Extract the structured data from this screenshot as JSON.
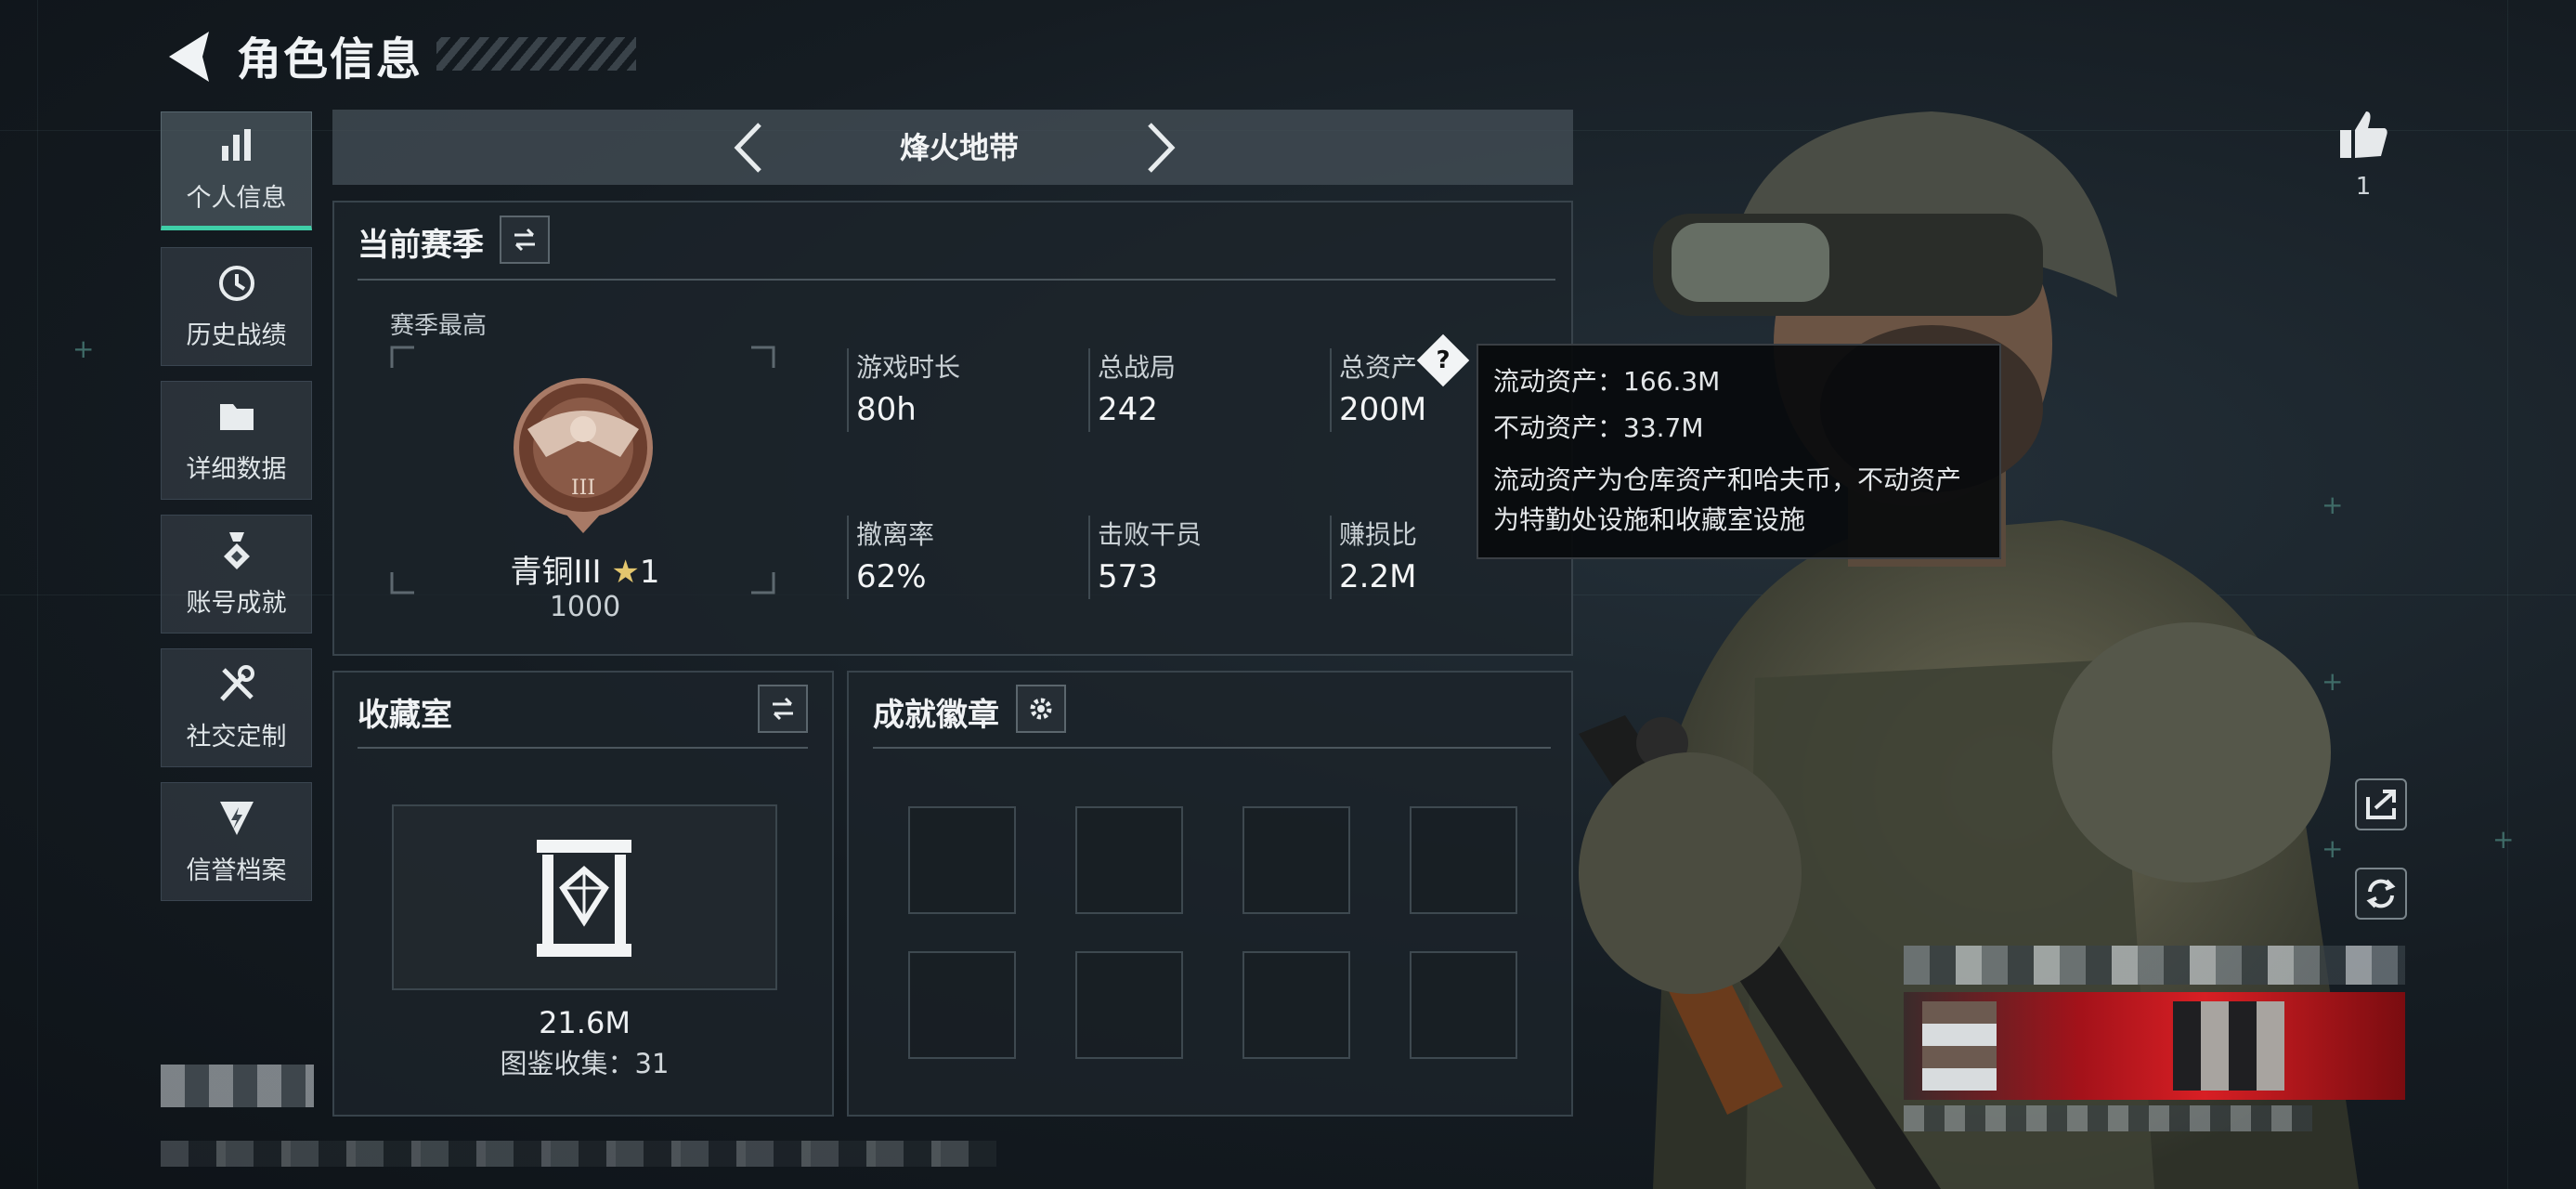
{
  "header": {
    "title": "角色信息"
  },
  "sidebar": {
    "items": [
      {
        "label": "个人信息",
        "icon": "bar-chart-icon",
        "active": true
      },
      {
        "label": "历史战绩",
        "icon": "clock-icon",
        "active": false
      },
      {
        "label": "详细数据",
        "icon": "folder-icon",
        "active": false
      },
      {
        "label": "账号成就",
        "icon": "medal-icon",
        "active": false
      },
      {
        "label": "社交定制",
        "icon": "tools-icon",
        "active": false
      },
      {
        "label": "信誉档案",
        "icon": "shield-icon",
        "active": false
      }
    ]
  },
  "mode_tab": {
    "title": "烽火地带"
  },
  "season": {
    "title": "当前赛季",
    "best_label": "赛季最高",
    "rank_name": "青铜III",
    "rank_stars": "1",
    "rank_points": "1000",
    "stats": [
      {
        "label": "游戏时长",
        "value": "80h"
      },
      {
        "label": "总战局",
        "value": "242"
      },
      {
        "label": "总资产",
        "value": "200M"
      },
      {
        "label": "撤离率",
        "value": "62%"
      },
      {
        "label": "击败干员",
        "value": "573"
      },
      {
        "label": "赚损比",
        "value": "2.2M"
      }
    ]
  },
  "tooltip": {
    "line1": "流动资产：166.3M",
    "line2": "不动资产：33.7M",
    "line3": "流动资产为仓库资产和哈夫币，不动资产",
    "line4": "为特勤处设施和收藏室设施"
  },
  "collection": {
    "title": "收藏室",
    "value": "21.6M",
    "catalog": "图鉴收集：31"
  },
  "achievements": {
    "title": "成就徽章",
    "slots": 8
  },
  "likes": {
    "count": "1"
  },
  "colors": {
    "accent": "#3fcfa8",
    "panel": "#1c242a",
    "tooltip_bg": "#08090b"
  }
}
